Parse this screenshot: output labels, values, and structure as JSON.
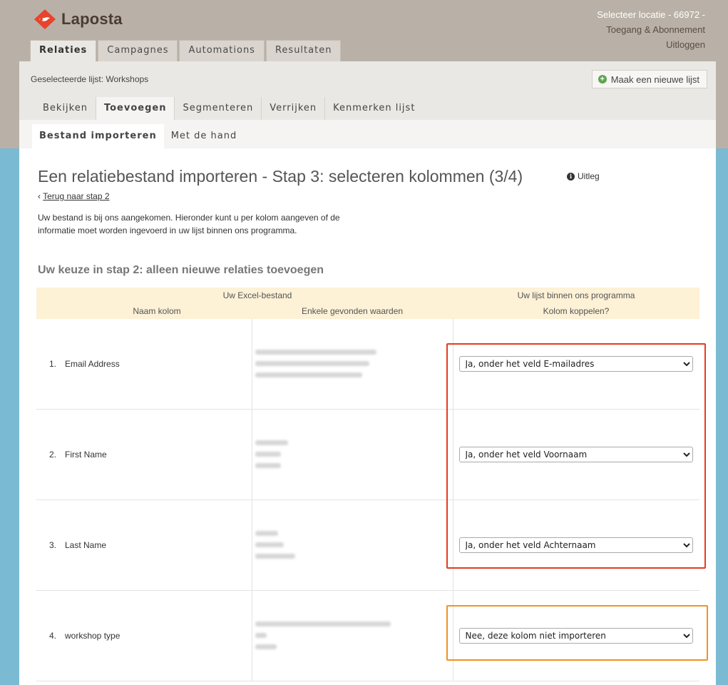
{
  "header": {
    "logo_text": "Laposta",
    "location": "Selecteer locatie - 66972 -",
    "account_link": "Toegang & Abonnement",
    "logout_link": "Uitloggen"
  },
  "main_tabs": [
    "Relaties",
    "Campagnes",
    "Automations",
    "Resultaten"
  ],
  "list_bar": {
    "selected_label": "Geselecteerde lijst:  Workshops",
    "new_list_button": "Maak een nieuwe lijst"
  },
  "sub_tabs": [
    "Bekijken",
    "Toevoegen",
    "Segmenteren",
    "Verrijken",
    "Kenmerken lijst"
  ],
  "third_tabs": [
    "Bestand importeren",
    "Met de hand"
  ],
  "page": {
    "title": "Een relatiebestand importeren - Stap 3: selecteren kolommen (3/4)",
    "help_link": "Uitleg",
    "back_arrow": "‹",
    "back_link": "Terug naar stap 2",
    "intro": "Uw bestand is bij ons aangekomen. Hieronder kunt u per kolom aangeven of de informatie moet worden ingevoerd in uw lijst binnen ons programma.",
    "choice": "Uw keuze in stap 2: alleen nieuwe relaties toevoegen"
  },
  "table": {
    "group_excel": "Uw Excel-bestand",
    "group_program": "Uw lijst binnen ons programma",
    "col_name": "Naam kolom",
    "col_values": "Enkele gevonden waarden",
    "col_map": "Kolom koppelen?",
    "rows": [
      {
        "num": "1.",
        "name": "Email Address",
        "mapping": "Ja, onder het veld E-mailadres"
      },
      {
        "num": "2.",
        "name": "First Name",
        "mapping": "Ja, onder het veld Voornaam"
      },
      {
        "num": "3.",
        "name": "Last Name",
        "mapping": "Ja, onder het veld Achternaam"
      },
      {
        "num": "4.",
        "name": "workshop type",
        "mapping": "Nee, deze kolom niet importeren"
      }
    ]
  },
  "colors": {
    "brand_red": "#e8432c",
    "highlight_red": "#e53b1f",
    "highlight_orange": "#f0931e",
    "header_band": "#b9b1a7",
    "background_blue": "#7bbad3"
  }
}
